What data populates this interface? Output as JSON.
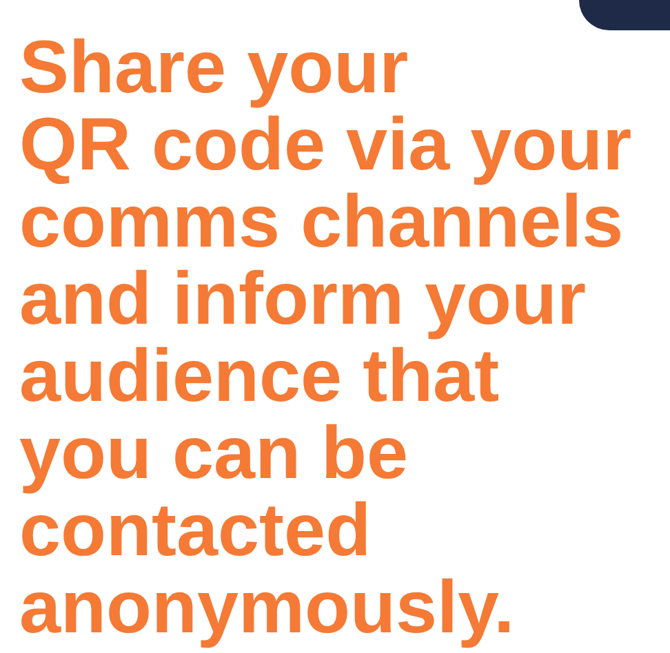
{
  "heading": "Share your\nQR code via your\ncomms channels\nand inform your\naudience that\nyou can be\ncontacted\nanonymously."
}
